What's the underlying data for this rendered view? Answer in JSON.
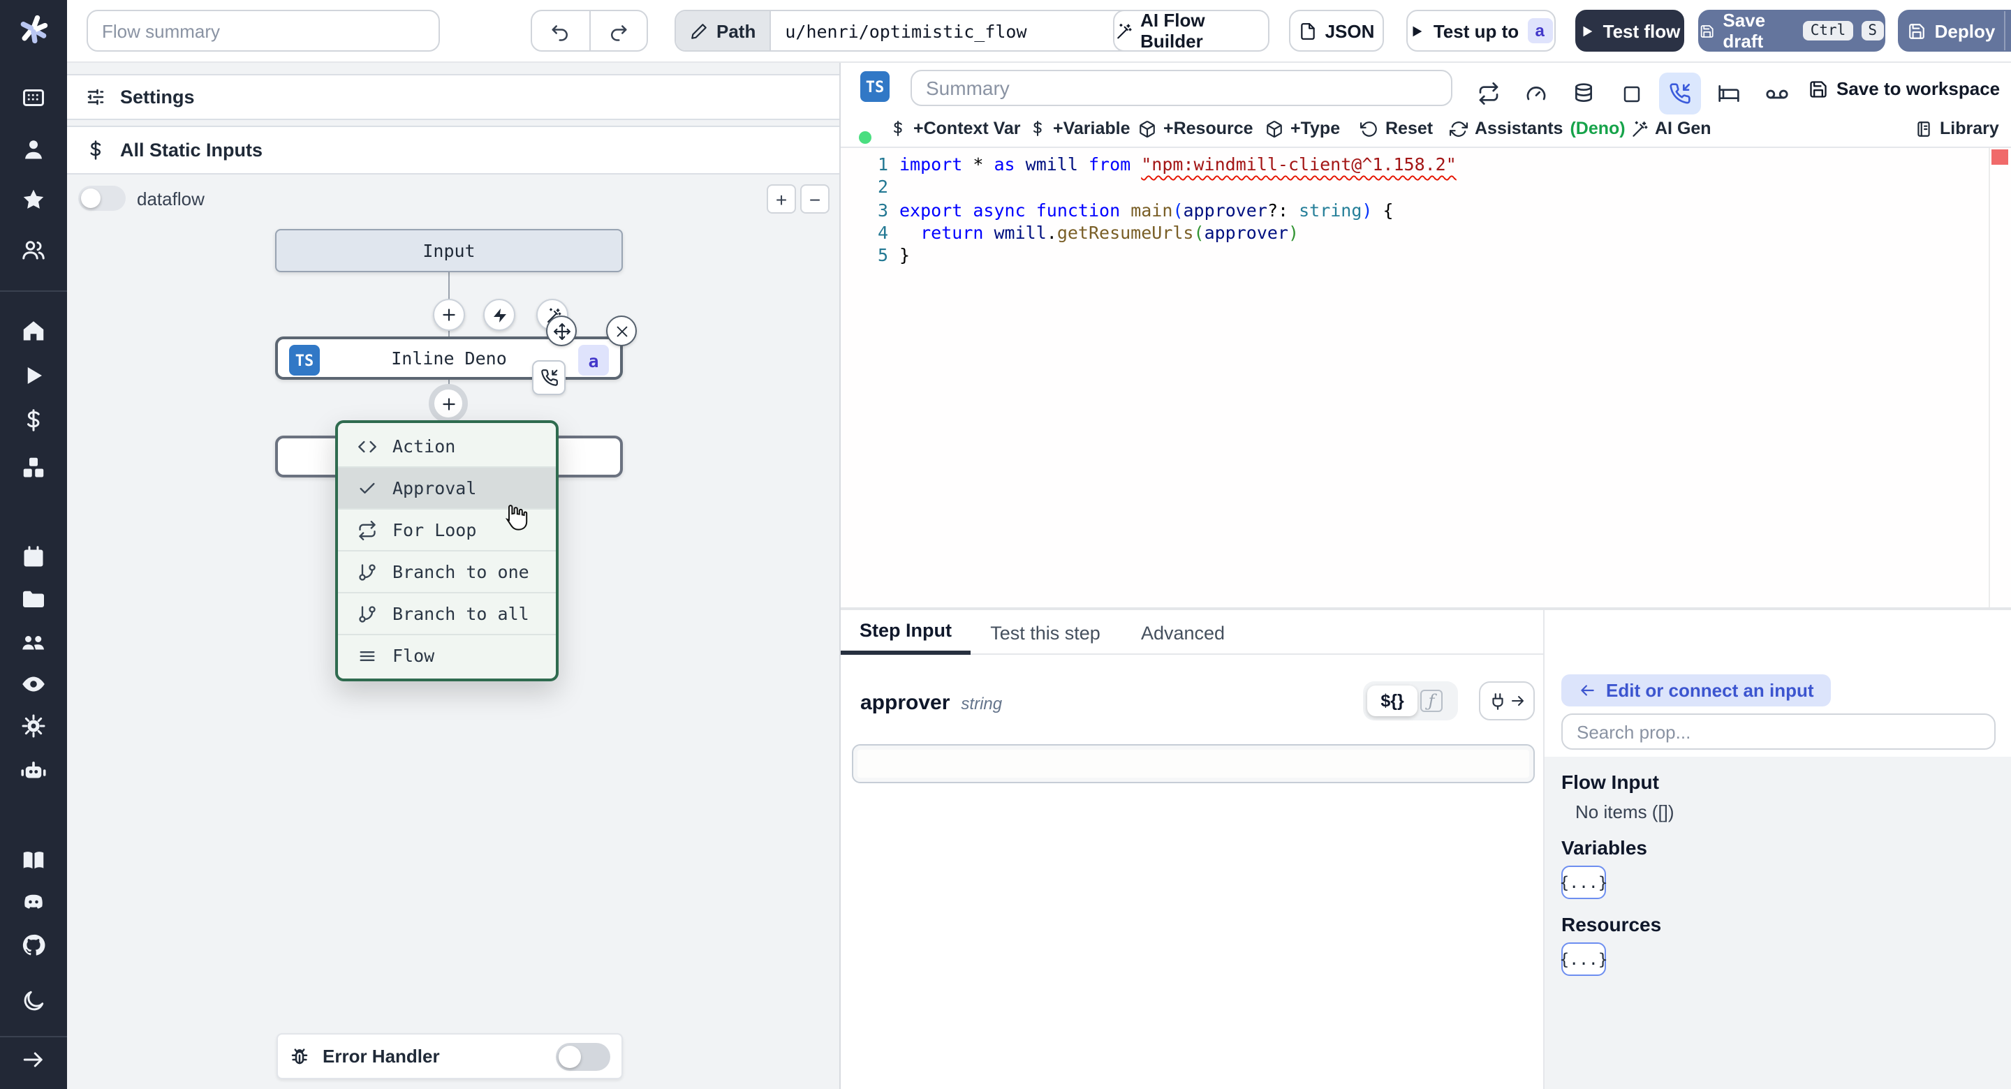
{
  "topbar": {
    "flow_summary_placeholder": "Flow summary",
    "path_label": "Path",
    "path_value": "u/henri/optimistic_flow",
    "ai_flow_builder_label": "AI Flow Builder",
    "json_label": "JSON",
    "test_up_to_label": "Test up to",
    "test_up_to_badge": "a",
    "test_flow_label": "Test flow",
    "save_draft_label": "Save draft",
    "save_draft_kbd": [
      "Ctrl",
      "S"
    ],
    "deploy_label": "Deploy"
  },
  "rail": {
    "icons": [
      "workspace-icon",
      "user-icon",
      "favorites-icon",
      "groups-icon",
      "home-icon",
      "runs-icon",
      "variables-icon",
      "resources-icon",
      "schedules-icon",
      "folders-icon",
      "members-icon",
      "audit-icon",
      "settings-icon",
      "workers-icon",
      "docs-icon",
      "discord-icon",
      "github-icon",
      "dark-mode-icon",
      "expand-icon"
    ]
  },
  "flow_panel": {
    "settings_label": "Settings",
    "all_static_inputs_label": "All Static Inputs",
    "dataflow_label": "dataflow",
    "zoom_in_label": "+",
    "zoom_out_label": "−",
    "input_node_label": "Input",
    "step_node": {
      "language_badge": "TS",
      "label": "Inline Deno",
      "step_id_badge": "a"
    },
    "insert_menu": {
      "highlighted_item": "Approval",
      "items": [
        {
          "icon": "code-icon",
          "label": "Action"
        },
        {
          "icon": "check-icon",
          "label": "Approval"
        },
        {
          "icon": "repeat-icon",
          "label": "For Loop"
        },
        {
          "icon": "git-branch-icon",
          "label": "Branch to one"
        },
        {
          "icon": "git-branch-icon",
          "label": "Branch to all"
        },
        {
          "icon": "menu-lines-icon",
          "label": "Flow"
        }
      ]
    },
    "error_handler_label": "Error Handler"
  },
  "editor": {
    "language_badge": "TS",
    "summary_placeholder": "Summary",
    "save_to_workspace_label": "Save to workspace",
    "status_dot_color": "#4ade80",
    "actions": {
      "context_var": "+Context Var",
      "variable": "+Variable",
      "resource": "+Resource",
      "type": "+Type",
      "reset": "Reset",
      "assistants": "Assistants",
      "assistants_lang": "(Deno)",
      "assistants_lang_color": "#16a34a",
      "ai_gen": "AI Gen",
      "library": "Library"
    },
    "code": {
      "gutter": [
        "1",
        "2",
        "3",
        "4",
        "5"
      ],
      "lines": [
        [
          [
            "kw",
            "import"
          ],
          [
            "p",
            " * "
          ],
          [
            "kw",
            "as"
          ],
          [
            "id",
            " wmill "
          ],
          [
            "kw",
            "from"
          ],
          [
            "p",
            " "
          ],
          [
            "strq",
            "\"npm:windmill-client@^1.158.2\""
          ]
        ],
        [],
        [
          [
            "kw",
            "export"
          ],
          [
            "p",
            " "
          ],
          [
            "kw",
            "async"
          ],
          [
            "p",
            " "
          ],
          [
            "kw",
            "function"
          ],
          [
            "fn",
            " main"
          ],
          [
            "b1",
            "("
          ],
          [
            "id",
            "approver"
          ],
          [
            "p",
            "?: "
          ],
          [
            "ty",
            "string"
          ],
          [
            "b1",
            ")"
          ],
          [
            "p",
            " {"
          ]
        ],
        [
          [
            "p",
            "  "
          ],
          [
            "kw",
            "return"
          ],
          [
            "id",
            " wmill"
          ],
          [
            "p",
            "."
          ],
          [
            "fn",
            "getResumeUrls"
          ],
          [
            "b2",
            "("
          ],
          [
            "id",
            "approver"
          ],
          [
            "b2",
            ")"
          ]
        ],
        [
          [
            "p",
            "}"
          ]
        ]
      ]
    }
  },
  "step_panel": {
    "tabs": [
      {
        "label": "Step Input",
        "active": true
      },
      {
        "label": "Test this step",
        "active": false
      },
      {
        "label": "Advanced",
        "active": false
      }
    ],
    "field": {
      "name": "approver",
      "type": "string"
    },
    "expr_button_label": "${}",
    "fn_button_label": "f"
  },
  "prop_picker": {
    "back_label": "Edit or connect an input",
    "search_placeholder": "Search prop...",
    "flow_input_title": "Flow Input",
    "flow_input_empty": "No items ([])",
    "variables_title": "Variables",
    "variables_chip": "{...}",
    "resources_title": "Resources",
    "resources_chip": "{...}"
  }
}
